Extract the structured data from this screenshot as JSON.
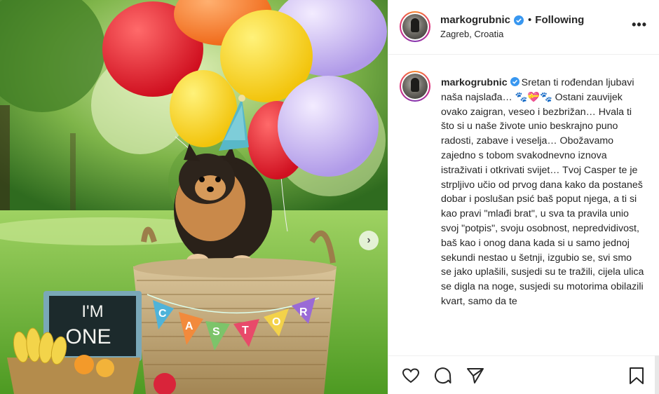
{
  "post": {
    "username": "markogrubnic",
    "follow_status": "Following",
    "separator": "•",
    "location": "Zagreb, Croatia",
    "more_label": "•••",
    "caption_text": "Sretan ti rođendan ljubavi naša najslađa… 🐾💝🐾 Ostani zauvijek ovako zaigran, veseo i bezbrižan… Hvala ti što si u naše živote unio beskrajno puno radosti, zabave i veselja… Obožavamo zajedno s tobom svakodnevno iznova istraživati i otkrivati svijet… Tvoj Casper te je strpljivo učio od prvog dana kako da postaneš dobar i poslušan psić baš poput njega, a ti si kao pravi \"mlađi brat\", u sva ta pravila unio svoj \"potpis\", svoju osobnost, nepredvidivost, baš kao i onog dana kada si u samo jednoj sekundi nestao u šetnji, izgubio se, svi smo se jako uplašili, susjedi su te tražili, cijela ulica se digla na noge, susjedi su motorima obilazili kvart, samo da te"
  },
  "photo": {
    "sign_line1": "I'M",
    "sign_line2": "ONE",
    "bunting_letters": [
      "C",
      "A",
      "S",
      "T",
      "O",
      "R"
    ],
    "next_icon": "chevron-right-icon"
  },
  "actions": {
    "like_icon": "heart-icon",
    "comment_icon": "comment-icon",
    "share_icon": "share-icon",
    "save_icon": "bookmark-icon"
  },
  "colors": {
    "verified_blue": "#3897f0",
    "text": "#262626",
    "border": "#efefef"
  }
}
